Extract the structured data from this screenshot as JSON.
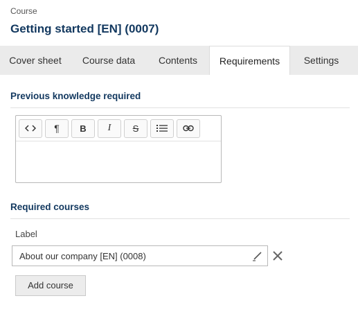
{
  "header": {
    "kicker": "Course",
    "title": "Getting started [EN] (0007)"
  },
  "tabs": [
    {
      "label": "Cover sheet",
      "active": false
    },
    {
      "label": "Course data",
      "active": false
    },
    {
      "label": "Contents",
      "active": false
    },
    {
      "label": "Requirements",
      "active": true
    },
    {
      "label": "Settings",
      "active": false
    }
  ],
  "previous_knowledge": {
    "title": "Previous knowledge required",
    "toolbar": [
      {
        "icon": "code-icon",
        "glyph": "<>"
      },
      {
        "icon": "paragraph-icon",
        "glyph": "¶"
      },
      {
        "icon": "bold-icon",
        "glyph": "B"
      },
      {
        "icon": "italic-icon",
        "glyph": "I"
      },
      {
        "icon": "strikethrough-icon",
        "glyph": "S"
      },
      {
        "icon": "bulleted-list-icon",
        "glyph": ""
      },
      {
        "icon": "link-icon",
        "glyph": ""
      }
    ],
    "content": ""
  },
  "required_courses": {
    "title": "Required courses",
    "label": "Label",
    "value": "About our company [EN] (0008)",
    "add_label": "Add course"
  },
  "colors": {
    "accent": "#12385f",
    "tab_bar": "#ebebeb"
  }
}
